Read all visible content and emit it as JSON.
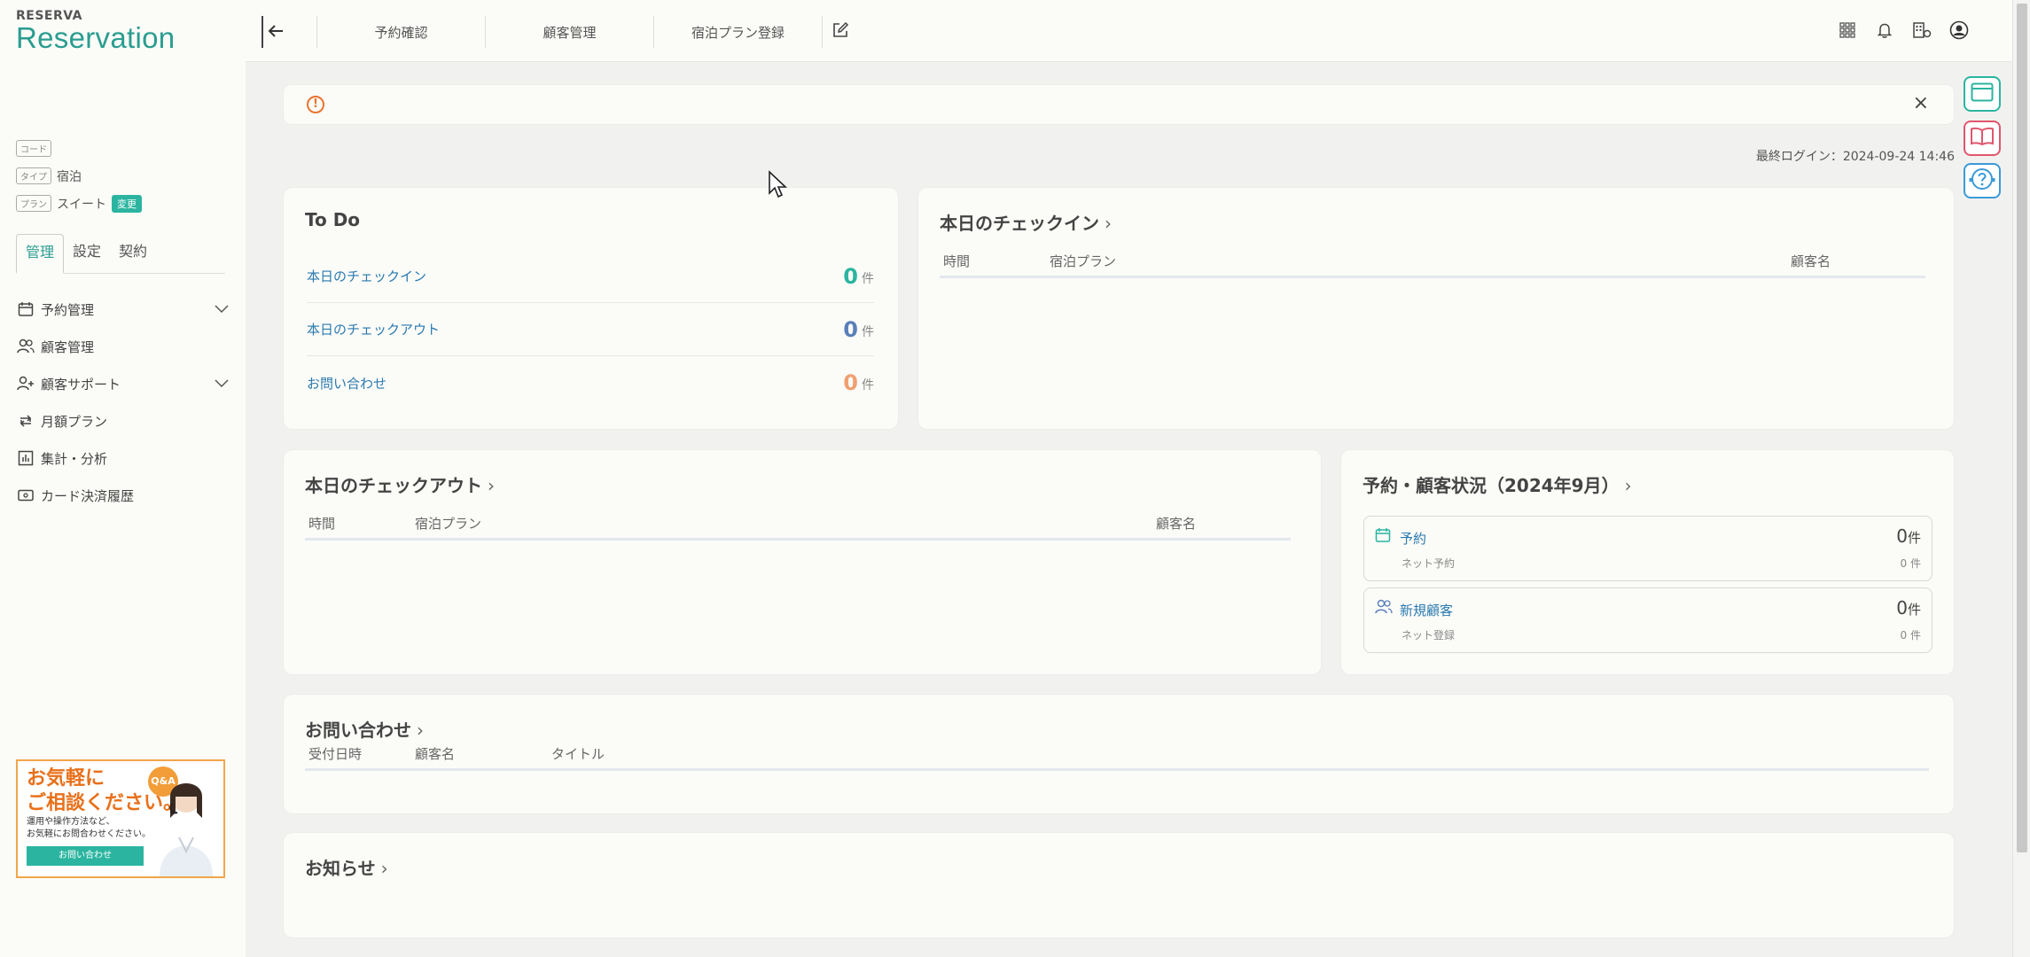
{
  "brand": {
    "small": "RESERVA",
    "big": "Reservation"
  },
  "meta": {
    "code_tag": "コード",
    "type_tag": "タイプ",
    "type_value": "宿泊",
    "plan_tag": "プラン",
    "plan_value": "スイート",
    "change_label": "変更"
  },
  "sidebar_tabs": [
    "管理",
    "設定",
    "契約"
  ],
  "nav": [
    {
      "label": "予約管理",
      "icon": "calendar-icon",
      "expandable": true
    },
    {
      "label": "顧客管理",
      "icon": "users-icon",
      "expandable": false
    },
    {
      "label": "顧客サポート",
      "icon": "user-plus-icon",
      "expandable": true
    },
    {
      "label": "月額プラン",
      "icon": "repeat-icon",
      "expandable": false
    },
    {
      "label": "集計・分析",
      "icon": "chart-icon",
      "expandable": false
    },
    {
      "label": "カード決済履歴",
      "icon": "card-icon",
      "expandable": false
    }
  ],
  "banner": {
    "title_line1": "お気軽に",
    "title_line2": "ご相談ください。",
    "qa": "Q&A",
    "desc_line1": "運用や操作方法など、",
    "desc_line2": "お気軽にお問合わせください。",
    "button": "お問い合わせ"
  },
  "topnav": [
    "予約確認",
    "顧客管理",
    "宿泊プラン登録"
  ],
  "alert": {
    "close": "×"
  },
  "last_login": "最終ログイン：2024-09-24 14:46",
  "todo": {
    "title": "To Do",
    "rows": [
      {
        "label": "本日のチェックイン",
        "count": "0",
        "unit": "件",
        "color": "#2bb5a0"
      },
      {
        "label": "本日のチェックアウト",
        "count": "0",
        "unit": "件",
        "color": "#5b7fb8"
      },
      {
        "label": "お問い合わせ",
        "count": "0",
        "unit": "件",
        "color": "#f0a070"
      }
    ]
  },
  "checkin": {
    "title": "本日のチェックイン",
    "arrow": "›",
    "headers": [
      "時間",
      "宿泊プラン",
      "顧客名"
    ]
  },
  "checkout": {
    "title": "本日のチェックアウト",
    "arrow": "›",
    "headers": [
      "時間",
      "宿泊プラン",
      "顧客名"
    ]
  },
  "status": {
    "title": "予約・顧客状況（2024年9月）",
    "arrow": "›",
    "items": [
      {
        "label": "予約",
        "sub": "ネット予約",
        "big": "0",
        "big_unit": "件",
        "small": "0 件",
        "icon": "calendar-icon"
      },
      {
        "label": "新規顧客",
        "sub": "ネット登録",
        "big": "0",
        "big_unit": "件",
        "small": "0 件",
        "icon": "users-icon"
      }
    ]
  },
  "inquiry": {
    "title": "お問い合わせ",
    "arrow": "›",
    "headers": [
      "受付日時",
      "顧客名",
      "タイトル"
    ]
  },
  "news": {
    "title": "お知らせ",
    "arrow": "›"
  },
  "colors": {
    "accent": "#2bb5a0",
    "link": "#2a7ab0",
    "warn": "#e8732f"
  }
}
